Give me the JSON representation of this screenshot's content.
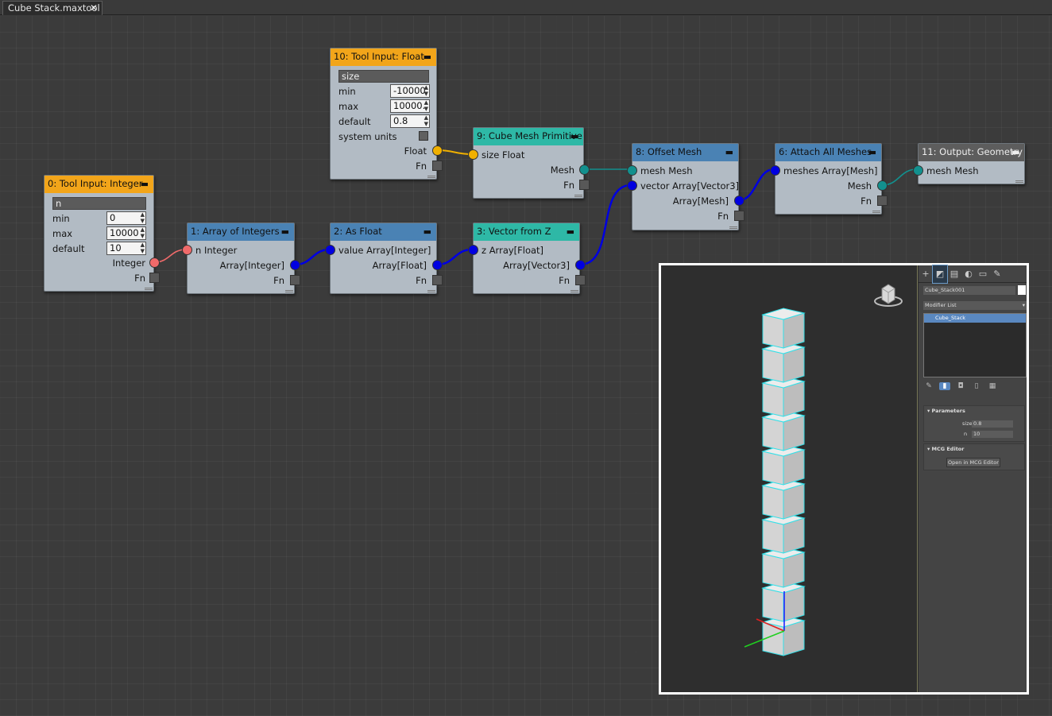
{
  "tab": {
    "title": "Cube Stack.maxtool",
    "close": "✕"
  },
  "nodes": {
    "n0": {
      "title": "0: Tool Input: Integer",
      "name": "n",
      "min_label": "min",
      "min": "0",
      "max_label": "max",
      "max": "10000",
      "default_label": "default",
      "default": "10",
      "out": "Integer",
      "fn": "Fn"
    },
    "n10": {
      "title": "10: Tool Input: Float",
      "name": "size",
      "min_label": "min",
      "min": "-10000",
      "max_label": "max",
      "max": "10000.",
      "default_label": "default",
      "default": "0.8",
      "units_label": "system units",
      "out": "Float",
      "fn": "Fn"
    },
    "n1": {
      "title": "1: Array of Integers",
      "in": "n Integer",
      "out": "Array[Integer]",
      "fn": "Fn"
    },
    "n2": {
      "title": "2: As Float",
      "in": "value Array[Integer]",
      "out": "Array[Float]",
      "fn": "Fn"
    },
    "n3": {
      "title": "3: Vector from Z",
      "in": "z Array[Float]",
      "out": "Array[Vector3]",
      "fn": "Fn"
    },
    "n9": {
      "title": "9: Cube Mesh Primitive",
      "in": "size Float",
      "out": "Mesh",
      "fn": "Fn"
    },
    "n8": {
      "title": "8: Offset Mesh",
      "in1": "mesh Mesh",
      "in2": "vector Array[Vector3]",
      "out": "Array[Mesh]",
      "fn": "Fn"
    },
    "n6": {
      "title": "6: Attach All Meshes",
      "in": "meshes Array[Mesh]",
      "out": "Mesh",
      "fn": "Fn"
    },
    "n11": {
      "title": "11: Output: Geometry",
      "in": "mesh Mesh"
    }
  },
  "minimize_glyph": "▬",
  "colors": {
    "integer": "#f06a6a",
    "array": "#0000e0",
    "float": "#f0b000",
    "mesh": "#12908e",
    "header_input": "#f2a51a",
    "header_op": "#4a82b4",
    "header_primitive": "#2eb8a6",
    "header_output": "#5d5d5d"
  },
  "viewport": {
    "object_name": "Cube_Stack001",
    "modifier_list": "Modifier List",
    "stack_item": "Cube_Stack",
    "parameters_title": "Parameters",
    "size_label": "size",
    "size_value": "0.8",
    "n_label": "n",
    "n_value": "10",
    "mcg_title": "MCG Editor",
    "open_button": "Open in MCG Editor",
    "cube_count": 10
  }
}
